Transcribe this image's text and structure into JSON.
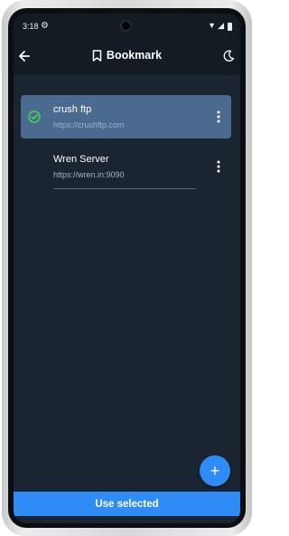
{
  "status_bar": {
    "time": "3:18"
  },
  "app_bar": {
    "title": "Bookmark"
  },
  "bookmarks": [
    {
      "name": "crush ftp",
      "url": "https://crushftp.com",
      "selected": true
    },
    {
      "name": "Wren Server",
      "url": "https://wren.in:9090",
      "selected": false
    }
  ],
  "fab": {
    "label": "+"
  },
  "footer": {
    "use_selected_label": "Use selected"
  },
  "colors": {
    "accent": "#2f8bf6",
    "selected_row": "#4b6a8f",
    "background": "#1a2531",
    "check": "#3ddc4a"
  }
}
